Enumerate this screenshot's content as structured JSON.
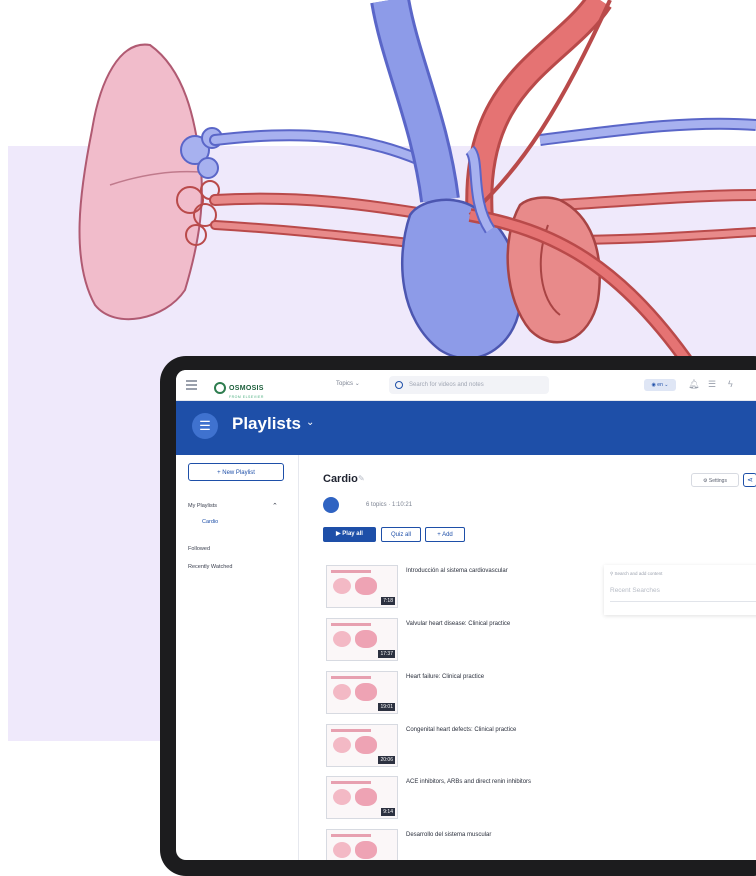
{
  "topbar": {
    "logo_text": "OSMOSIS",
    "logo_sub": "FROM ELSEVIER",
    "topics_label": "Topics",
    "search_placeholder": "Search for videos and notes",
    "language": "en"
  },
  "header": {
    "title": "Playlists"
  },
  "sidebar": {
    "new_playlist": "+ New Playlist",
    "my_playlists": "My Playlists",
    "playlist_item": "Cardio",
    "followed": "Followed",
    "recently_watched": "Recently Watched"
  },
  "main": {
    "title": "Cardio",
    "meta": "6 topics · 1:10:21",
    "play_all": "▶ Play all",
    "quiz_all": "Quiz all",
    "add": "+ Add",
    "settings": "Settings"
  },
  "search_panel": {
    "placeholder": "Search and add content",
    "recent": "Recent Searches"
  },
  "topics": [
    {
      "title": "Introducción al sistema cardiovascular",
      "duration": "7:18"
    },
    {
      "title": "Valvular heart disease: Clinical practice",
      "duration": "17:37"
    },
    {
      "title": "Heart failure: Clinical practice",
      "duration": "19:01"
    },
    {
      "title": "Congenital heart defects: Clinical practice",
      "duration": "20:06"
    },
    {
      "title": "ACE inhibitors, ARBs and direct renin inhibitors",
      "duration": "9:14"
    },
    {
      "title": "Desarrollo del sistema muscular",
      "duration": ""
    }
  ],
  "colors": {
    "brand_blue": "#1e4fa8",
    "background_lavender": "#efe9fb",
    "artery_red": "#e57373",
    "vein_blue": "#8d9be8",
    "lung_pink": "#f1bccb"
  }
}
